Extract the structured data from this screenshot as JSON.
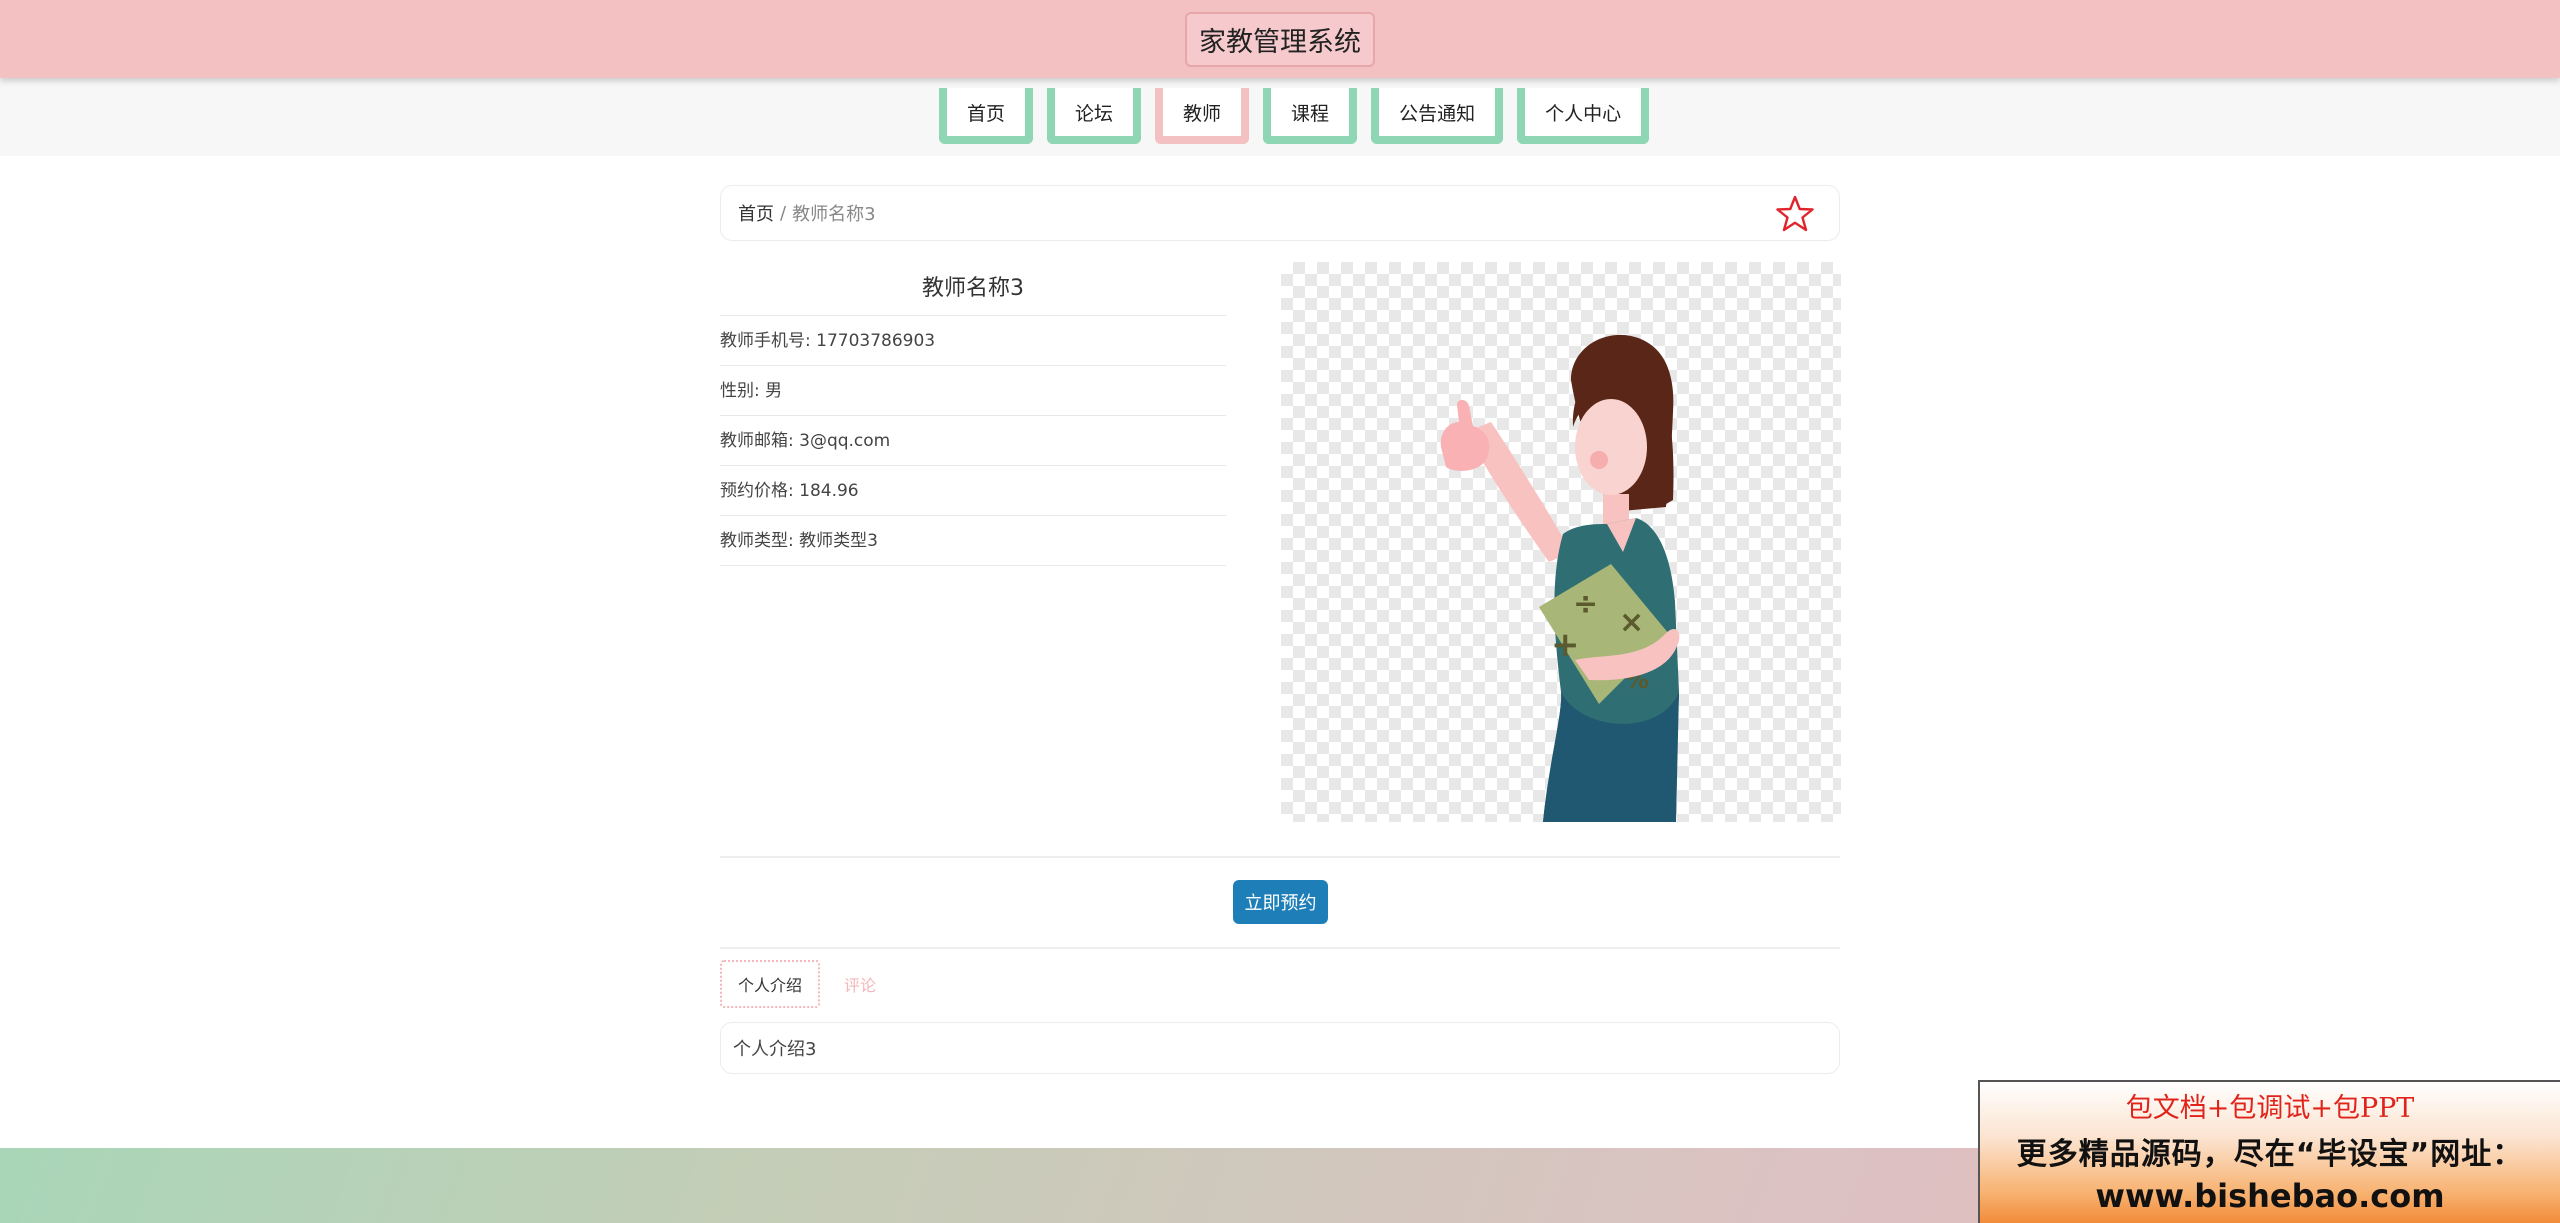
{
  "header": {
    "title": "家教管理系统"
  },
  "nav": {
    "items": [
      {
        "label": "首页"
      },
      {
        "label": "论坛"
      },
      {
        "label": "教师"
      },
      {
        "label": "课程"
      },
      {
        "label": "公告通知"
      },
      {
        "label": "个人中心"
      }
    ],
    "active_index": 2,
    "active_color": "#f4c1c3",
    "inactive_color": "#8fd7b4"
  },
  "breadcrumb": {
    "home": "首页",
    "separator": "/",
    "current": "教师名称3"
  },
  "teacher": {
    "name": "教师名称3",
    "fields": [
      {
        "label": "教师手机号: 17703786903"
      },
      {
        "label": "性别: 男"
      },
      {
        "label": "教师邮箱: 3@qq.com"
      },
      {
        "label": "预约价格: 184.96"
      },
      {
        "label": "教师类型: 教师类型3"
      }
    ]
  },
  "book_button": {
    "label": "立即预约",
    "color": "#1e7fb8"
  },
  "tabs": [
    {
      "label": "个人介绍"
    },
    {
      "label": "评论"
    }
  ],
  "intro": {
    "text": "个人介绍3"
  },
  "ad": {
    "line1": "包文档+包调试+包PPT",
    "line2": "更多精品源码，尽在“毕设宝”网址：",
    "line3": "www.bishebao.com"
  },
  "icons": {
    "favorite": "star-outline-icon"
  }
}
